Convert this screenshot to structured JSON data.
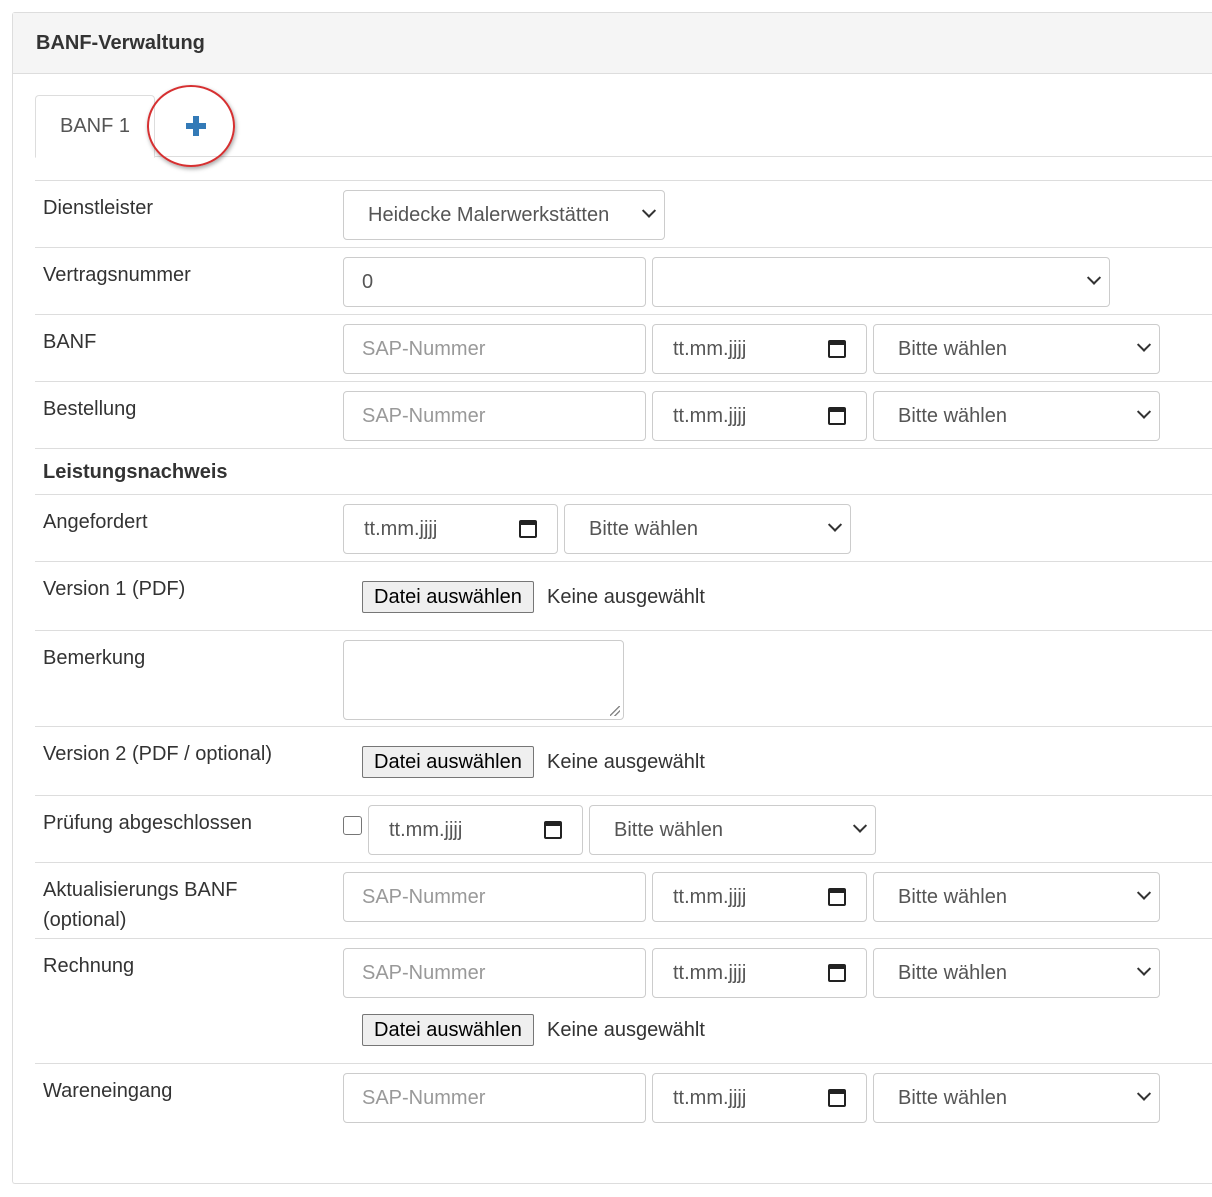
{
  "panel": {
    "title": "BANF-Verwaltung"
  },
  "tabs": {
    "active_label": "BANF 1",
    "add_label": "+"
  },
  "placeholders": {
    "sap": "SAP-Nummer",
    "date": "tt.mm.jjjj",
    "select": "Bitte wählen"
  },
  "file": {
    "button": "Datei auswählen",
    "status": "Keine ausgewählt"
  },
  "rows": {
    "dienstleister": {
      "label": "Dienstleister",
      "value": "Heidecke Malerwerkstätten"
    },
    "vertragsnummer": {
      "label": "Vertragsnummer",
      "value": "0",
      "select_value": ""
    },
    "banf": {
      "label": "BANF"
    },
    "bestellung": {
      "label": "Bestellung"
    },
    "leistungsnachweis": {
      "label": "Leistungsnachweis"
    },
    "angefordert": {
      "label": "Angefordert"
    },
    "version1": {
      "label": "Version 1 (PDF)"
    },
    "bemerkung": {
      "label": "Bemerkung",
      "value": ""
    },
    "version2": {
      "label": "Version 2 (PDF / optional)"
    },
    "pruefung": {
      "label": "Prüfung abgeschlossen",
      "checked": false
    },
    "aktualisierung": {
      "label_line1": "Aktualisierungs BANF",
      "label_line2": "(optional)"
    },
    "rechnung": {
      "label": "Rechnung"
    },
    "wareneingang": {
      "label": "Wareneingang"
    }
  },
  "colors": {
    "accent": "#337ab7",
    "highlight": "#d63031",
    "border": "#dddddd"
  }
}
